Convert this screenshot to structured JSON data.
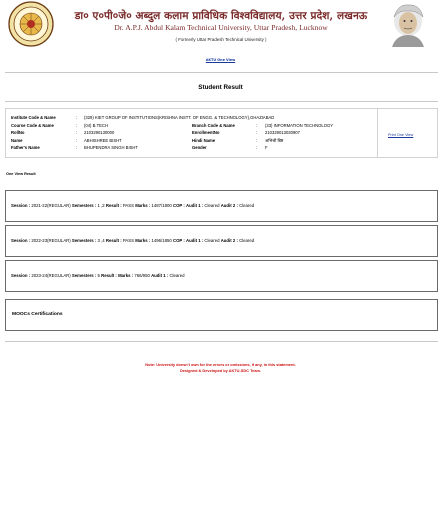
{
  "header": {
    "title_hindi": "डा० ए०पी०जे० अब्दुल कलाम प्राविधिक विश्वविद्यालय, उत्तर प्रदेश, लखनऊ",
    "title_english": "Dr. A.P.J. Abdul Kalam Technical University, Uttar Pradesh, Lucknow",
    "former_name": "( Formerly Uttar Pradesh Technical University )"
  },
  "aktu_link": "AKTU One View",
  "page_title": "Student Result",
  "student": {
    "institute_code_label": "Institute Code & Name",
    "institute_code_value": "(329) KIET GROUP OF INSTITUTIONS(KRISHNA INSTT. OF ENGG. & TECHNOLOGY),GHAZIABAD",
    "course_label": "Course Code & Name",
    "course_value": "(04) B.TECH",
    "branch_label": "Branch Code & Name",
    "branch_value": "(33) INFORMATION TECHNOLOGY",
    "rollno_label": "RollNo",
    "rollno_value": "2103290130000",
    "enrollment_label": "EnrollmentNo",
    "enrollment_value": "210329013030907",
    "name_label": "Name",
    "name_value": "ABHISHREE BISHT",
    "hindi_name_label": "Hindi Name",
    "hindi_name_value": "अभिश्री बिष्ट",
    "father_label": "Father's Name",
    "father_value": "BHUPENDRA SINGH BISHT",
    "gender_label": "Gender",
    "gender_value": "F",
    "colon": ":"
  },
  "print_link": "Print One View",
  "one_view_label": "One View Result",
  "sessions": [
    {
      "session_label": "Session :",
      "session_value": "2021-22(REGULAR)",
      "semesters_label": "Semesters :",
      "semesters_value": "1 ,2",
      "result_label": "Result :",
      "result_value": "PASS",
      "marks_label": "Marks :",
      "marks_value": "1487/1800",
      "cop_label": "COP :",
      "audit1_label": "Audit 1 :",
      "audit1_value": "Cleared",
      "audit2_label": "Audit 2 :",
      "audit2_value": "Cleared"
    },
    {
      "session_label": "Session :",
      "session_value": "2022-23(REGULAR)",
      "semesters_label": "Semesters :",
      "semesters_value": "3 ,4",
      "result_label": "Result :",
      "result_value": "PASS",
      "marks_label": "Marks :",
      "marks_value": "1496/1850",
      "cop_label": "COP :",
      "audit1_label": "Audit 1 :",
      "audit1_value": "Cleared",
      "audit2_label": "Audit 2 :",
      "audit2_value": "Cleared"
    },
    {
      "session_label": "Session :",
      "session_value": "2023-24(REGULAR)",
      "semesters_label": "Semesters :",
      "semesters_value": "5",
      "result_label": "Result :",
      "marks_label": "Marks :",
      "marks_value": "766/950",
      "audit1_label": "Audit 1 :",
      "audit1_value": "Cleared"
    }
  ],
  "mooc_title": "MOOCs Certifications",
  "note_line1": "Note: University doesn't own for the errors or omissions, if any, in this statement.",
  "note_line2": "Designed & Developed by AKTU-SDC Team.",
  "colors": {
    "title": "#7a2a2a",
    "link": "#1a3a9c",
    "note": "#cc1111",
    "box_border": "#6a6a6a"
  }
}
